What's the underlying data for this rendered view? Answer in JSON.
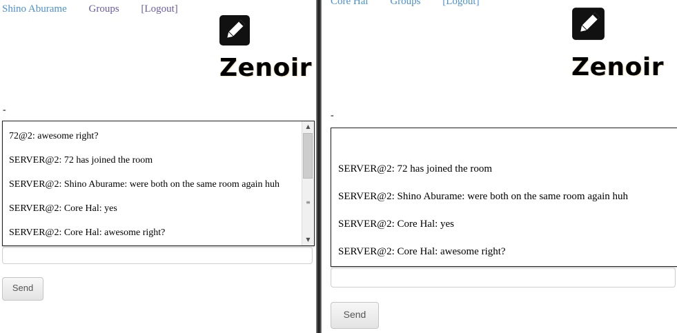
{
  "app": {
    "logo_text": "Zenoir",
    "logo_icon": "edit-square-icon"
  },
  "left_pane": {
    "nav": {
      "user": "Shino Aburame",
      "groups": "Groups",
      "logout": "[Logout]"
    },
    "dash": "-",
    "messages": [
      "72@2: awesome right?",
      "SERVER@2: 72 has joined the room",
      "SERVER@2: Shino Aburame: were both on the same room again huh",
      "SERVER@2: Core Hal: yes",
      "SERVER@2: Core Hal: awesome right?"
    ],
    "input_value": "",
    "send_label": "Send"
  },
  "right_pane": {
    "nav": {
      "user": "Core Hal",
      "groups": "Groups",
      "logout": "[Logout]"
    },
    "dash": "-",
    "messages": [
      "SERVER@2: 72 has joined the room",
      "SERVER@2: Shino Aburame: were both on the same room again huh",
      "SERVER@2: Core Hal: yes",
      "SERVER@2: Core Hal: awesome right?"
    ],
    "input_value": "",
    "send_label": "Send"
  },
  "colors": {
    "link": "#4a90d6",
    "visited_link": "#6a5aa8"
  }
}
